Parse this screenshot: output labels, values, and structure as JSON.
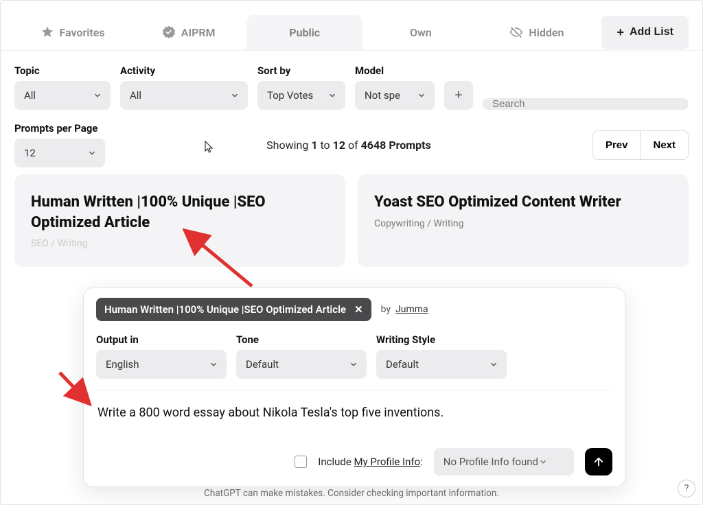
{
  "tabs": {
    "favorites": "Favorites",
    "aiprm": "AIPRM",
    "public": "Public",
    "own": "Own",
    "hidden": "Hidden",
    "add_list": "Add List"
  },
  "filters": {
    "topic_label": "Topic",
    "topic_value": "All",
    "activity_label": "Activity",
    "activity_value": "All",
    "sort_label": "Sort by",
    "sort_value": "Top Votes",
    "model_label": "Model",
    "model_value": "Not spe",
    "search_placeholder": "Search",
    "ppp_label": "Prompts per Page",
    "ppp_value": "12"
  },
  "pager": {
    "showing_prefix": "Showing ",
    "from": "1",
    "to_word": " to ",
    "to": "12",
    "of_word": " of ",
    "total": "4648 Prompts",
    "prev": "Prev",
    "next": "Next"
  },
  "cards": [
    {
      "title": "Human Written |100% Unique |SEO Optimized Article",
      "meta": "SEO / Writing"
    },
    {
      "title": "Yoast SEO Optimized Content Writer",
      "meta": "Copywriting / Writing"
    }
  ],
  "panel": {
    "chip": "Human Written |100% Unique |SEO Optimized Article",
    "by_label": "by",
    "author": "Jumma",
    "output_label": "Output in",
    "output_value": "English",
    "tone_label": "Tone",
    "tone_value": "Default",
    "style_label": "Writing Style",
    "style_value": "Default",
    "prompt_text": "Write a 800 word essay about Nikola Tesla's top five inventions.",
    "include_prefix": "Include ",
    "include_link": "My Profile Info",
    "include_suffix": ":",
    "profile_select": "No Profile Info found"
  },
  "footer": "ChatGPT can make mistakes. Consider checking important information."
}
